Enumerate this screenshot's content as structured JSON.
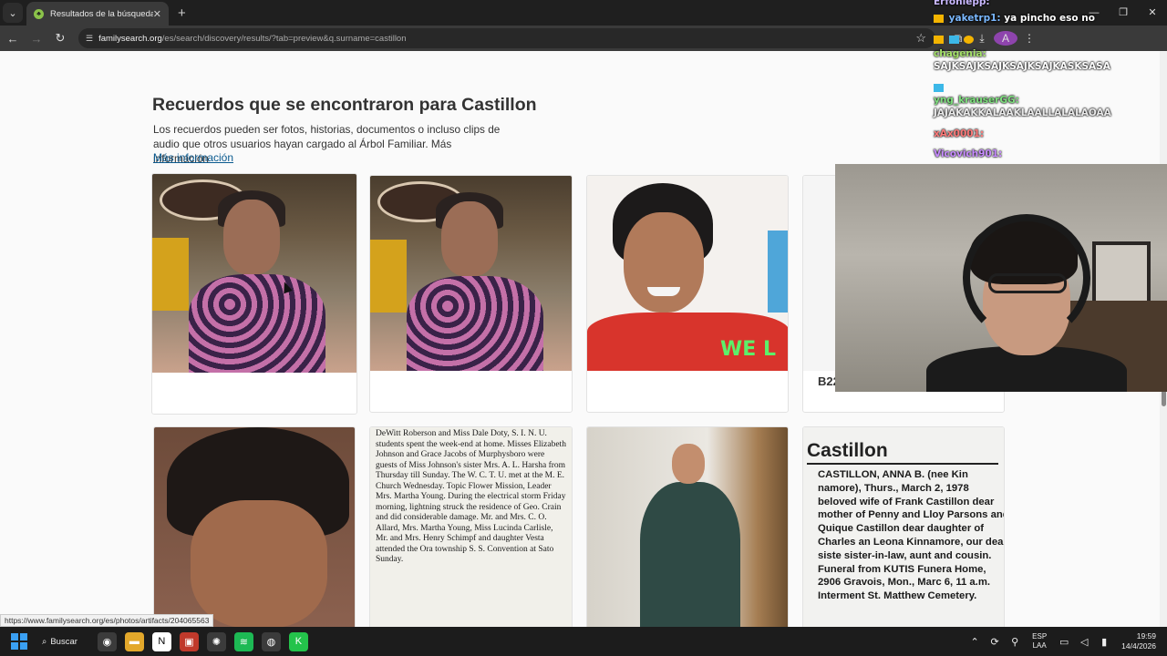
{
  "browser": {
    "tab_title": "Resultados de la búsqueda",
    "url_host": "familysearch.org",
    "url_path": "/es/search/discovery/results/?tab=preview&q.surname=castillon",
    "profile_initial": "A"
  },
  "page": {
    "heading": "Recuerdos que se encontraron para Castillon",
    "description": "Los recuerdos pueden ser fotos, historias, documentos o incluso clips de audio que otros usuarios hayan cargado al Árbol Familiar. Más información",
    "more_link": "Más información",
    "cards": [
      {
        "caption": ""
      },
      {
        "caption": ""
      },
      {
        "caption": ""
      },
      {
        "caption": "B22"
      }
    ],
    "newspaper_text": "DeWitt Roberson and Miss Dale Doty, S. I. N. U. students spent the week-end at home. Misses Elizabeth Johnson and Grace Jacobs of Murphysboro were guests of Miss Johnson's sister Mrs. A. L. Harsha from Thursday till Sunday. The W. C. T. U. met at the M. E. Church Wednesday. Topic Flower Mission, Leader Mrs. Martha Young. During the electrical storm Friday morning, lightning struck the residence of Geo. Crain and did considerable damage. Mr. and Mrs. C. O. Allard, Mrs. Martha Young, Miss Lucinda Carlisle, Mr. and Mrs. Henry Schimpf and daughter Vesta attended the Ora township S. S. Convention at Sato Sunday.",
    "obit_title": "Castillon",
    "obit_text": "CASTILLON, ANNA B. (nee Kin namore), Thurs., March 2, 1978 beloved wife of Frank Castillon dear mother of Penny and Lloy Parsons and Quique Castillon dear daughter of Charles an Leona Kinnamore, our dear siste sister-in-law, aunt and cousin. Funeral from KUTIS Funera Home, 2906 Gravois, Mon., Marc 6, 11 a.m. Interment St. Matthew Cemetery.",
    "smile_overlay_text": "WE L",
    "status_url": "https://www.familysearch.org/es/photos/artifacts/204065563"
  },
  "chat": [
    {
      "user": "Erfoniepp:",
      "text": ""
    },
    {
      "user": "yaketrp1:",
      "text": "ya pincho eso no"
    },
    {
      "user": "chagenia:",
      "text": "SAJKSAJKSAJKSAJKSAJKASKSASA"
    },
    {
      "user": "yng_krauserGG:",
      "text": "JAJAKAKKALAAKLAALLALALAOAA"
    },
    {
      "user": "xAx0001:",
      "text": ""
    },
    {
      "user": "Vicovich901:",
      "text": ""
    }
  ],
  "taskbar": {
    "search_label": "Buscar",
    "lang_top": "ESP",
    "lang_bottom": "LAA",
    "time": "19:59",
    "date": "14/4/2026"
  },
  "colors": {
    "link": "#0a5a8f",
    "heading": "#333333",
    "page_bg": "#fafafa"
  }
}
